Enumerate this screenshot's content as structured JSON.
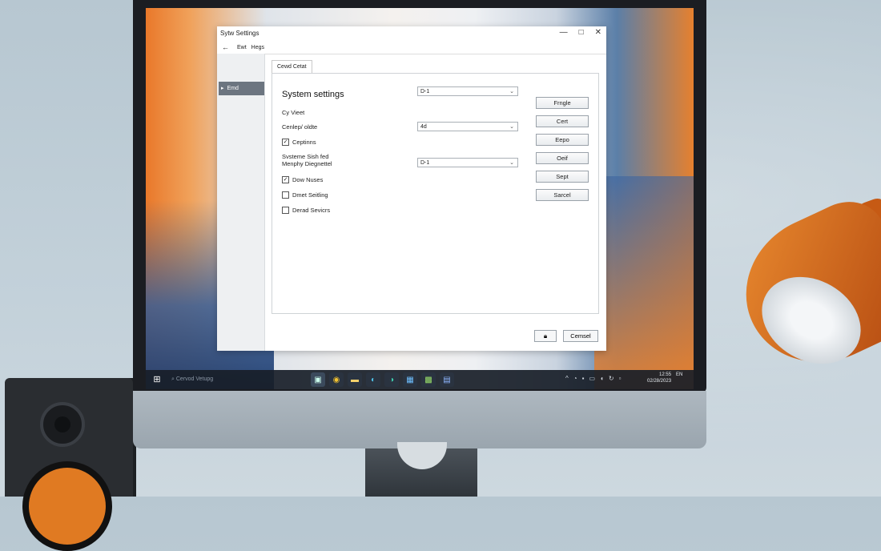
{
  "window": {
    "title": "Sytw Settings",
    "controls": {
      "minimize": "—",
      "maximize": "□",
      "close": "✕"
    }
  },
  "menubar": {
    "back_icon": "back-arrow-icon",
    "items": [
      "Ewt",
      "Hegs"
    ]
  },
  "sidebar": {
    "items": [
      {
        "label": "Emd",
        "icon": "folder-icon",
        "selected": true
      }
    ]
  },
  "tab": {
    "label": "Cewd  Cetat"
  },
  "panel": {
    "heading": "System settings",
    "labels": {
      "cy_vieet": "Cy Vieet",
      "cenlep_idate": "Cenlep/ oldte",
      "system_line1": "Svsteme Sish fed",
      "system_line2": "Menphy Diegnettel"
    },
    "checkboxes": [
      {
        "label": "Ceptinns",
        "checked": true
      },
      {
        "label": "Dow Nuses",
        "checked": true
      },
      {
        "label": "Dmet Seitling",
        "checked": false
      },
      {
        "label": "Derad Sevicrs",
        "checked": false
      }
    ],
    "dropdowns": [
      {
        "value": "D-1"
      },
      {
        "value": "4d"
      },
      {
        "value": "D-1"
      }
    ]
  },
  "side_buttons": [
    "Frngle",
    "Cert",
    "Eepo",
    "Oeif",
    "Sept",
    "Sarcel"
  ],
  "footer": {
    "lock_icon": "lock-icon",
    "cancel_label": "Cemsel"
  },
  "taskbar": {
    "search_text": "Cervod Vetupg",
    "apps": [
      "monitor-app-icon",
      "chrome-icon",
      "files-icon",
      "edge-icon",
      "edge-alt-icon",
      "store-icon",
      "photos-icon",
      "word-icon"
    ],
    "tray_icons": [
      "chevron-up-icon",
      "wifi-icon",
      "network-icon",
      "battery-icon",
      "volume-icon",
      "sync-icon",
      "notification-icon"
    ],
    "clock_line1": "12:55",
    "clock_line2": "02/28/2023",
    "lang": "EN"
  }
}
